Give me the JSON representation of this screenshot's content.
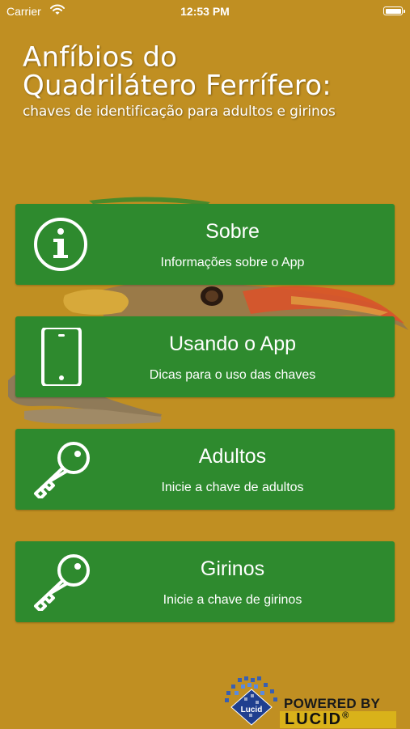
{
  "status_bar": {
    "carrier": "Carrier",
    "time": "12:53 PM"
  },
  "header": {
    "title_line1": "Anfíbios do",
    "title_line2": "Quadrilátero Ferrífero:",
    "subtitle": "chaves de identificação para adultos e girinos"
  },
  "menu": [
    {
      "icon": "info-icon",
      "title": "Sobre",
      "description": "Informações sobre o App"
    },
    {
      "icon": "phone-icon",
      "title": "Usando o App",
      "description": "Dicas para o uso das chaves"
    },
    {
      "icon": "key-icon",
      "title": "Adultos",
      "description": "Inicie a chave de adultos"
    },
    {
      "icon": "key-icon",
      "title": "Girinos",
      "description": "Inicie a chave de girinos"
    }
  ],
  "footer": {
    "powered_by": "POWERED BY",
    "brand": "LUCID",
    "brand_mark": "®",
    "logo_text": "Lucid"
  },
  "colors": {
    "background": "#c08f22",
    "button": "#2e8a2e",
    "text": "#ffffff"
  }
}
